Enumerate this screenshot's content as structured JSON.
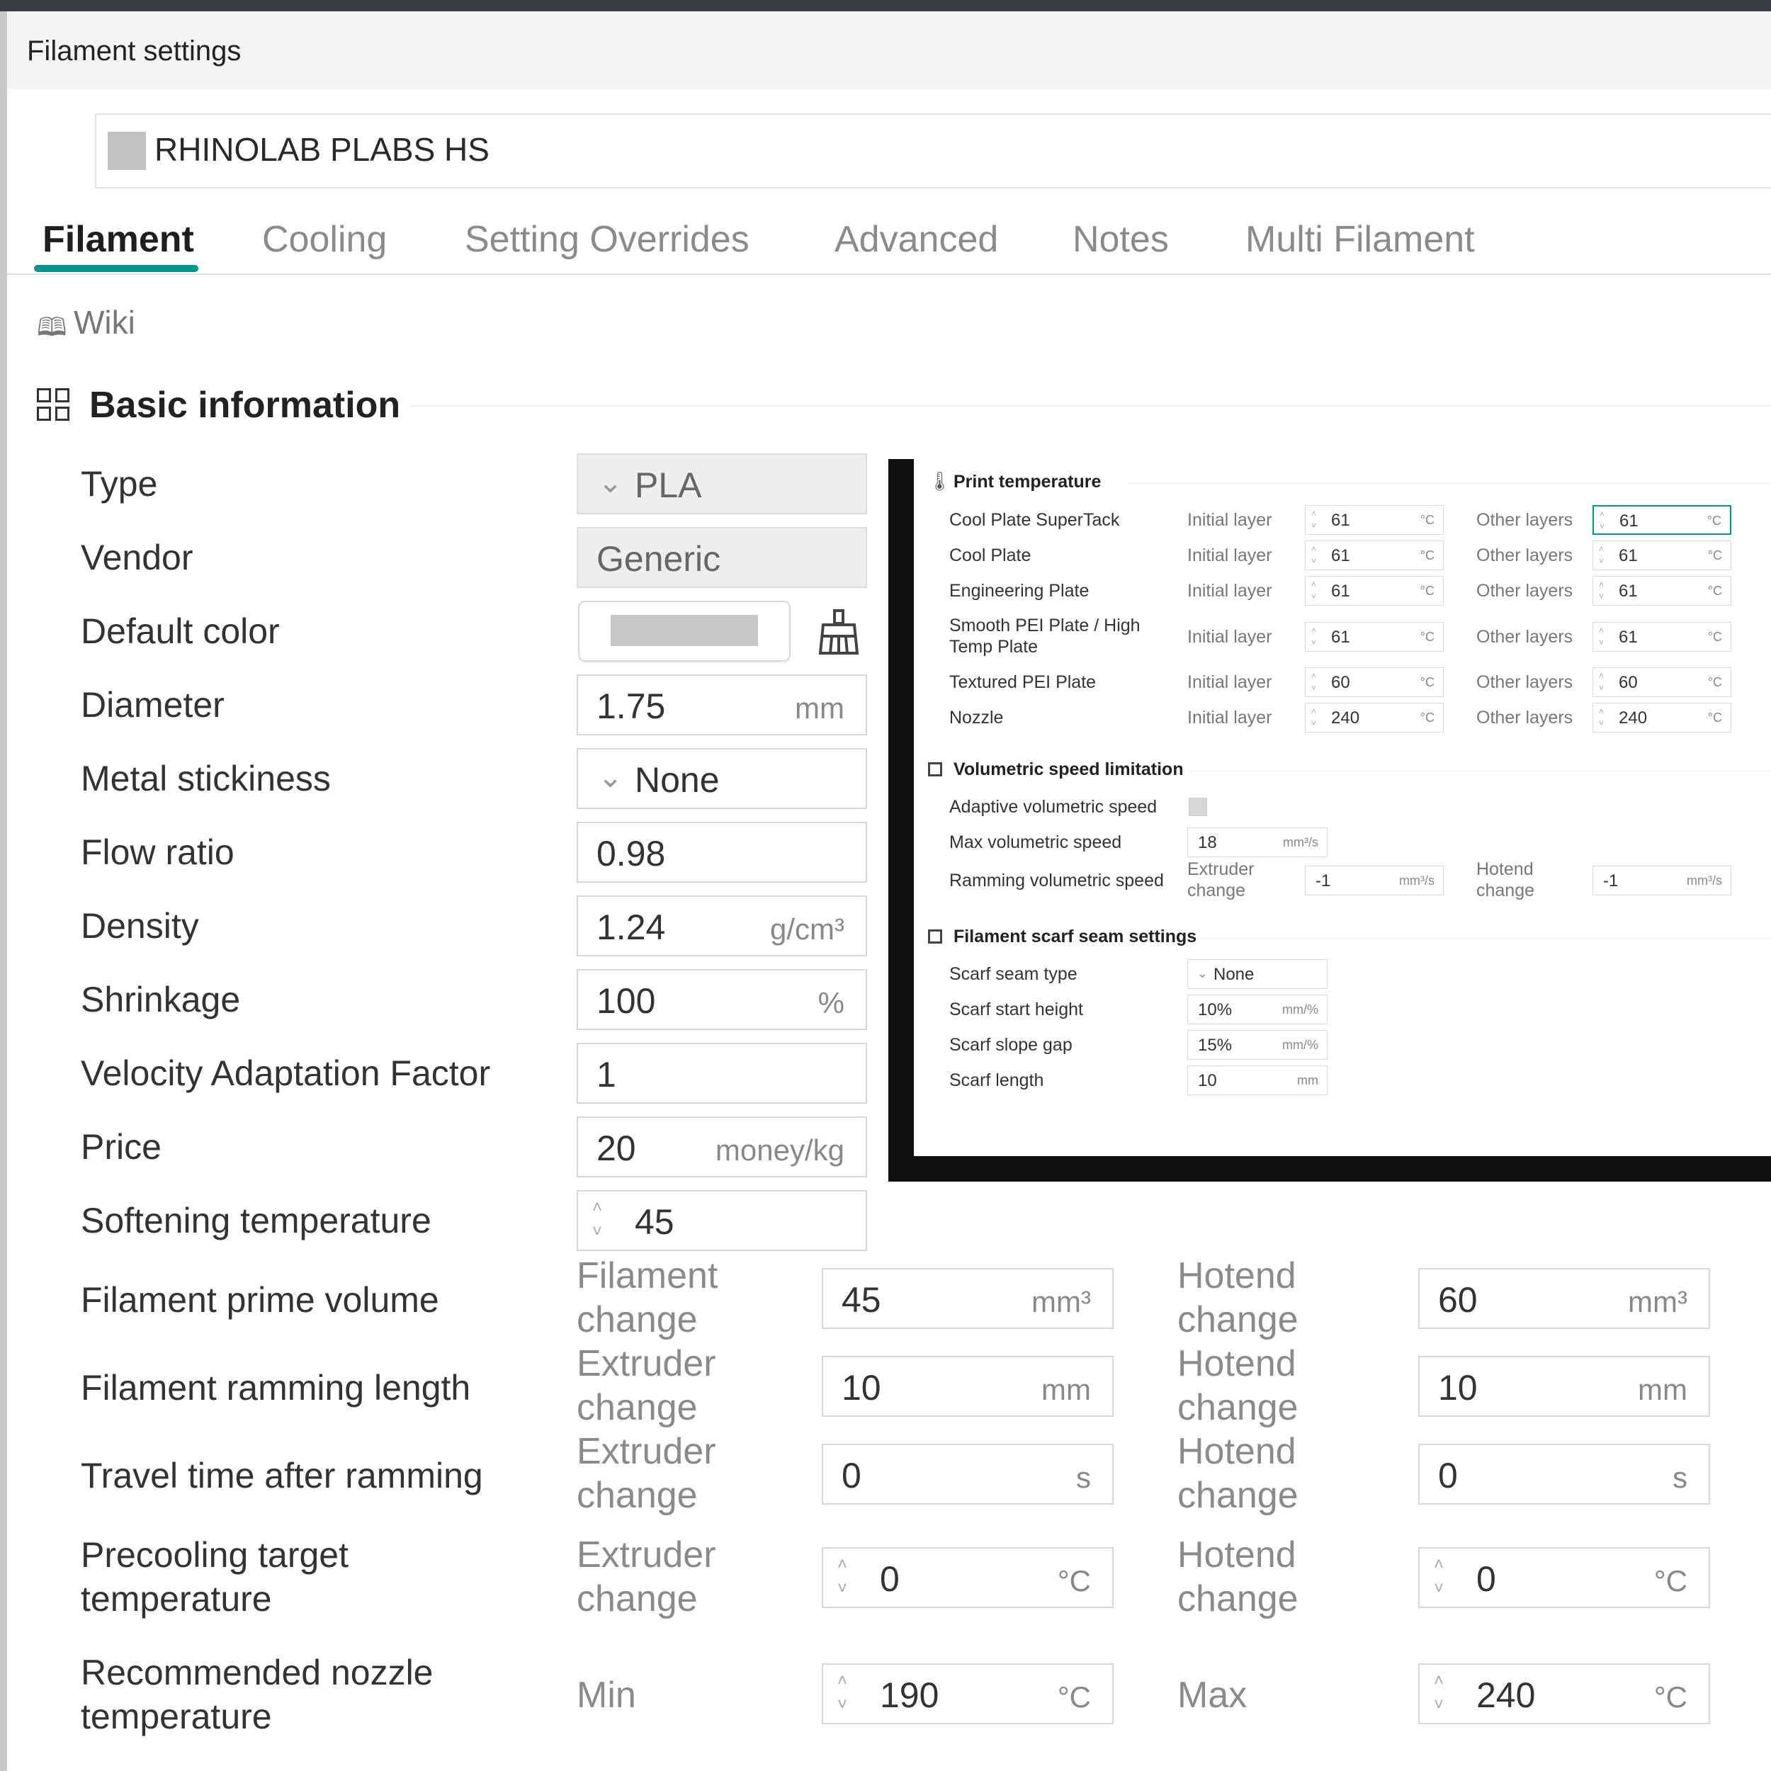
{
  "window": {
    "title": "Filament settings"
  },
  "preset": {
    "name": "RHINOLAB PLABS HS"
  },
  "tabs": [
    "Filament",
    "Cooling",
    "Setting Overrides",
    "Advanced",
    "Notes",
    "Multi Filament"
  ],
  "wiki": {
    "label": "Wiki"
  },
  "colors": {
    "accent": "#009688",
    "swatch": "#c2c2c2"
  },
  "basic": {
    "title": "Basic information",
    "type": {
      "label": "Type",
      "value": "PLA"
    },
    "vendor": {
      "label": "Vendor",
      "value": "Generic"
    },
    "default_color": {
      "label": "Default color"
    },
    "diameter": {
      "label": "Diameter",
      "value": "1.75",
      "unit": "mm"
    },
    "metal_stickiness": {
      "label": "Metal stickiness",
      "value": "None"
    },
    "flow_ratio": {
      "label": "Flow ratio",
      "value": "0.98"
    },
    "density": {
      "label": "Density",
      "value": "1.24",
      "unit": "g/cm³"
    },
    "shrinkage": {
      "label": "Shrinkage",
      "value": "100",
      "unit": "%"
    },
    "velocity": {
      "label": "Velocity Adaptation Factor",
      "value": "1"
    },
    "price": {
      "label": "Price",
      "value": "20",
      "unit": "money/kg"
    },
    "softening": {
      "label": "Softening temperature",
      "value": "45"
    }
  },
  "wide": {
    "prime": {
      "label": "Filament prime volume",
      "sub1": "Filament change",
      "val1": "45",
      "unit1": "mm³",
      "sub2": "Hotend change",
      "val2": "60",
      "unit2": "mm³"
    },
    "ramming": {
      "label": "Filament ramming length",
      "sub1": "Extruder change",
      "val1": "10",
      "unit1": "mm",
      "sub2": "Hotend change",
      "val2": "10",
      "unit2": "mm"
    },
    "travel": {
      "label": "Travel time after ramming",
      "sub1": "Extruder change",
      "val1": "0",
      "unit1": "s",
      "sub2": "Hotend change",
      "val2": "0",
      "unit2": "s"
    },
    "precool": {
      "label": "Precooling target temperature",
      "sub1": "Extruder change",
      "val1": "0",
      "unit1": "°C",
      "sub2": "Hotend change",
      "val2": "0",
      "unit2": "°C"
    },
    "nozzle": {
      "label": "Recommended nozzle temperature",
      "sub1": "Min",
      "val1": "190",
      "unit1": "°C",
      "sub2": "Max",
      "val2": "240",
      "unit2": "°C"
    }
  },
  "inset": {
    "print_temp": {
      "title": "Print temperature",
      "initial_label": "Initial layer",
      "other_label": "Other layers",
      "unit": "°C",
      "rows": [
        {
          "label": "Cool Plate SuperTack",
          "initial": "61",
          "other": "61"
        },
        {
          "label": "Cool Plate",
          "initial": "61",
          "other": "61"
        },
        {
          "label": "Engineering Plate",
          "initial": "61",
          "other": "61"
        },
        {
          "label": "Smooth PEI Plate / High Temp Plate",
          "initial": "61",
          "other": "61"
        },
        {
          "label": "Textured PEI Plate",
          "initial": "60",
          "other": "60"
        },
        {
          "label": "Nozzle",
          "initial": "240",
          "other": "240"
        }
      ]
    },
    "volumetric": {
      "title": "Volumetric speed limitation",
      "adaptive_label": "Adaptive volumetric speed",
      "max_label": "Max volumetric speed",
      "max_value": "18",
      "max_unit": "mm³/s",
      "ramming_label": "Ramming volumetric speed",
      "extruder_sub": "Extruder change",
      "extruder_value": "-1",
      "hotend_sub": "Hotend change",
      "hotend_value": "-1",
      "unit": "mm³/s"
    },
    "scarf": {
      "title": "Filament scarf seam settings",
      "type_label": "Scarf seam type",
      "type_value": "None",
      "start_label": "Scarf start height",
      "start_value": "10%",
      "start_unit": "mm/%",
      "gap_label": "Scarf slope gap",
      "gap_value": "15%",
      "gap_unit": "mm/%",
      "length_label": "Scarf length",
      "length_value": "10",
      "length_unit": "mm"
    }
  }
}
